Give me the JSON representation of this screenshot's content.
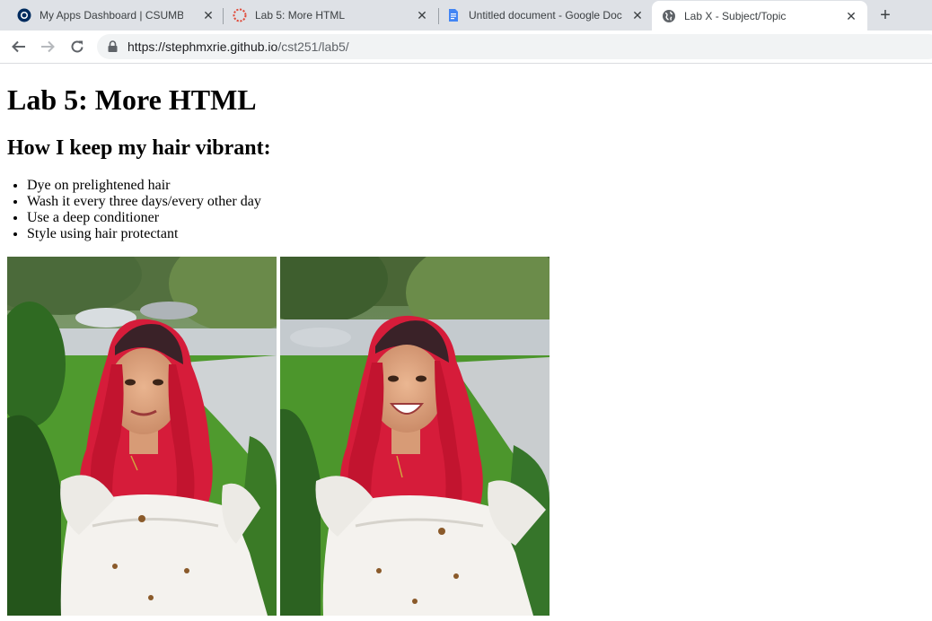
{
  "browser": {
    "tabs": [
      {
        "title": "My Apps Dashboard | CSUMB",
        "favicon": "csumb-logo-icon",
        "active": false
      },
      {
        "title": "Lab 5: More HTML",
        "favicon": "loading-spinner-icon",
        "active": false
      },
      {
        "title": "Untitled document - Google Doc",
        "favicon": "google-docs-icon",
        "active": false
      },
      {
        "title": "Lab X - Subject/Topic",
        "favicon": "globe-icon",
        "active": true
      }
    ],
    "address": {
      "host": "https://stephmxrie.github.io",
      "path": "/cst251/lab5/"
    }
  },
  "page": {
    "title": "Lab 5: More HTML",
    "subtitle": "How I keep my hair vibrant:",
    "tips": [
      "Dye on prelightened hair",
      "Wash it every three days/every other day",
      "Use a deep conditioner",
      "Style using hair protectant"
    ]
  },
  "colors": {
    "hair": "#d61c3a",
    "dress": "#f4f2ee",
    "grass": "#4f9a2e",
    "tabstrip": "#dee1e6"
  }
}
